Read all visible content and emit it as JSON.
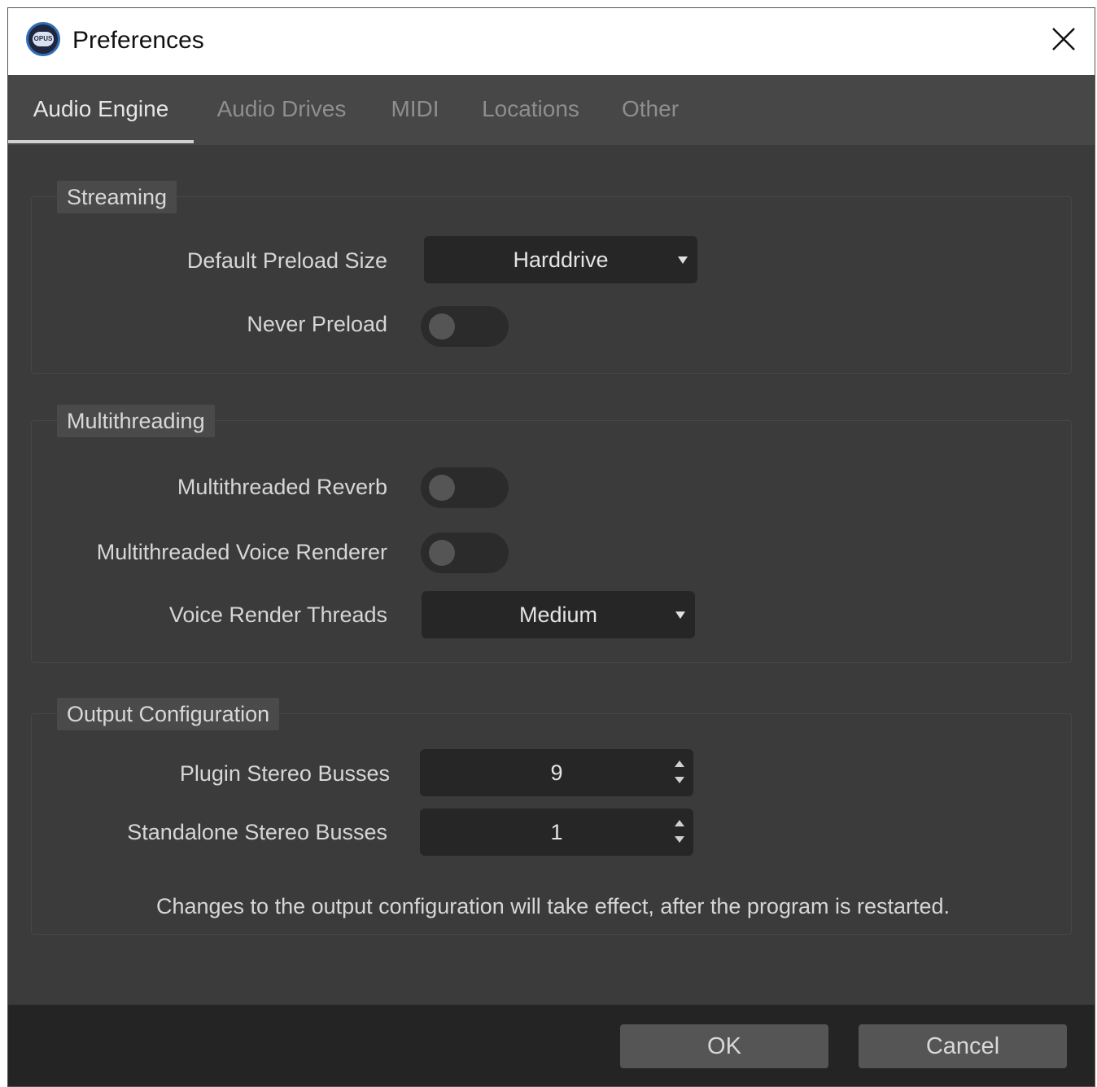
{
  "window": {
    "title": "Preferences",
    "icon": "opus-app-icon",
    "icon_text": "OPUS",
    "close_icon": "close-icon"
  },
  "tabs": [
    {
      "label": "Audio Engine",
      "active": true
    },
    {
      "label": "Audio Drives",
      "active": false
    },
    {
      "label": "MIDI",
      "active": false
    },
    {
      "label": "Locations",
      "active": false
    },
    {
      "label": "Other",
      "active": false
    }
  ],
  "streaming": {
    "title": "Streaming",
    "preload_size_label": "Default Preload Size",
    "preload_size_value": "Harddrive",
    "never_preload_label": "Never Preload",
    "never_preload_on": false
  },
  "multithreading": {
    "title": "Multithreading",
    "reverb_label": "Multithreaded Reverb",
    "reverb_on": false,
    "voice_renderer_label": "Multithreaded Voice Renderer",
    "voice_renderer_on": false,
    "threads_label": "Voice Render Threads",
    "threads_value": "Medium"
  },
  "output": {
    "title": "Output Configuration",
    "plugin_busses_label": "Plugin Stereo Busses",
    "plugin_busses_value": "9",
    "standalone_busses_label": "Standalone Stereo Busses",
    "standalone_busses_value": "1",
    "note": "Changes to the output configuration will take effect, after the program is restarted."
  },
  "footer": {
    "ok_label": "OK",
    "cancel_label": "Cancel"
  },
  "colors": {
    "background": "#3b3b3b",
    "tabbar": "#474747",
    "control": "#262626",
    "footer": "#242424",
    "button": "#555555"
  }
}
